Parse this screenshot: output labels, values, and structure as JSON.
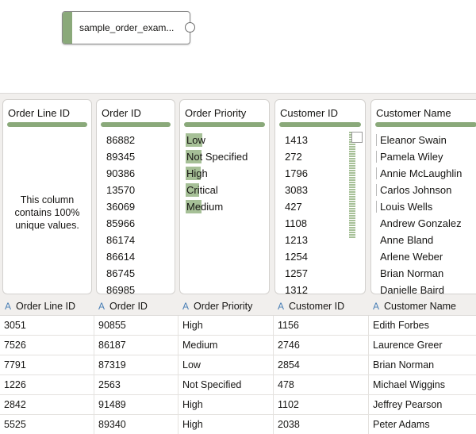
{
  "node": {
    "label": "sample_order_exam..."
  },
  "profile": {
    "order_line_id": {
      "title": "Order Line ID",
      "message": "This column contains 100% unique values."
    },
    "order_id": {
      "title": "Order ID",
      "values": [
        "86882",
        "89345",
        "90386",
        "13570",
        "36069",
        "85966",
        "86174",
        "86614",
        "86745",
        "86985"
      ]
    },
    "order_priority": {
      "title": "Order Priority",
      "values": [
        {
          "label": "Low",
          "fraction": 0.95
        },
        {
          "label": "Not Specified",
          "fraction": 0.9
        },
        {
          "label": "High",
          "fraction": 0.85
        },
        {
          "label": "Critical",
          "fraction": 0.75
        },
        {
          "label": "Medium",
          "fraction": 0.9
        }
      ]
    },
    "customer_id": {
      "title": "Customer ID",
      "values": [
        "1413",
        "272",
        "1796",
        "3083",
        "427",
        "1108",
        "1213",
        "1254",
        "1257",
        "1312"
      ]
    },
    "customer_name": {
      "title": "Customer Name",
      "values": [
        "Eleanor Swain",
        "Pamela Wiley",
        "Annie McLaughlin",
        "Carlos Johnson",
        "Louis Wells",
        "Andrew Gonzalez",
        "Anne Bland",
        "Arlene Weber",
        "Brian Norman",
        "Danielle Baird"
      ]
    }
  },
  "grid": {
    "type_icon": "A",
    "columns": [
      "Order Line ID",
      "Order ID",
      "Order Priority",
      "Customer ID",
      "Customer Name"
    ],
    "rows": [
      [
        "3051",
        "90855",
        "High",
        "1156",
        "Edith Forbes"
      ],
      [
        "7526",
        "86187",
        "Medium",
        "2746",
        "Laurence Greer"
      ],
      [
        "7791",
        "87319",
        "Low",
        "2854",
        "Brian Norman"
      ],
      [
        "1226",
        "2563",
        "Not Specified",
        "478",
        "Michael Wiggins"
      ],
      [
        "2842",
        "91489",
        "High",
        "1102",
        "Jeffrey Pearson"
      ],
      [
        "5525",
        "89340",
        "High",
        "2038",
        "Peter Adams"
      ]
    ]
  },
  "colors": {
    "accent": "#8aa97a",
    "bar": "#a6c097",
    "type_icon": "#4a7fb5"
  }
}
